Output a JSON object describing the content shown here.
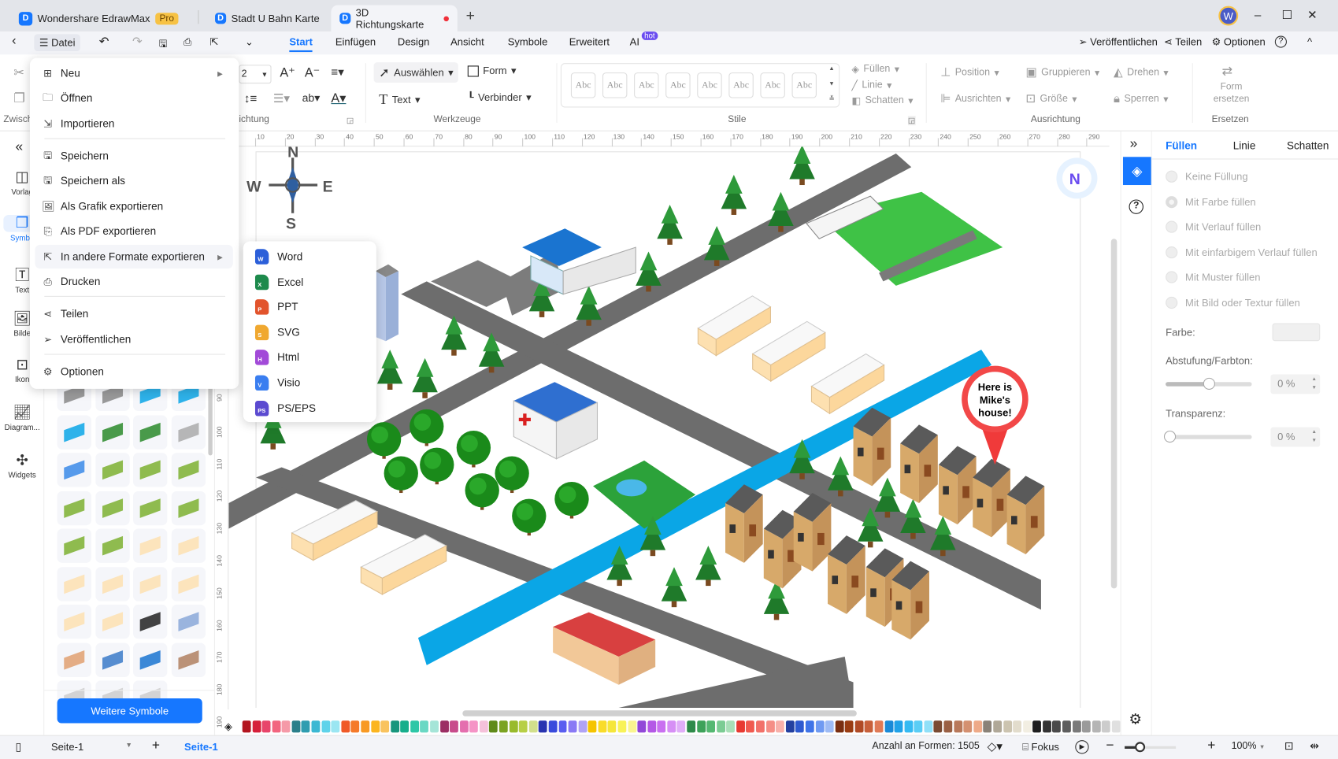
{
  "titlebar": {
    "app_name": "Wondershare EdrawMax",
    "pro_badge": "Pro",
    "tabs": [
      {
        "label": "Stadt U Bahn Karte"
      },
      {
        "label": "3D Richtungskarte",
        "unsaved": true
      }
    ],
    "new_tab": "+",
    "avatar_letter": "W",
    "minimize": "–",
    "maximize": "☐",
    "close": "✕"
  },
  "menubar": {
    "back": "‹",
    "datei": "Datei",
    "undo": "↶",
    "redo": "↷",
    "tabs": [
      "Start",
      "Einfügen",
      "Design",
      "Ansicht",
      "Symbole",
      "Erweitert",
      "AI"
    ],
    "active_tab": "Start",
    "ai_badge": "hot",
    "right": {
      "publish": "Veröffentlichen",
      "share": "Teilen",
      "options": "Optionen",
      "help": "?",
      "collapse": "^"
    }
  },
  "ribbon": {
    "font_size": "2",
    "select": "Auswählen",
    "form": "Form",
    "text": "Text",
    "connector": "Verbinder",
    "style_sample": "Abc",
    "fill": "Füllen",
    "line": "Linie",
    "shadow": "Schatten",
    "position": "Position",
    "group": "Gruppieren",
    "rotate": "Drehen",
    "align": "Ausrichten",
    "size": "Größe",
    "lock": "Sperren",
    "replace_form": "Form ersetzen",
    "groups": {
      "clipboard": "Zwisch",
      "alignment_partial": "ichtung",
      "tools": "Werkzeuge",
      "styles": "Stile",
      "arrangement": "Ausrichtung",
      "replace": "Ersetzen"
    }
  },
  "left_sidebar": {
    "collapse": "«",
    "items": [
      {
        "label": "Vorlag",
        "icon": "template-icon"
      },
      {
        "label": "Symbo",
        "icon": "symbols-icon",
        "active": true
      },
      {
        "label": "Text",
        "icon": "text-icon"
      },
      {
        "label": "Bilde",
        "icon": "image-icon"
      },
      {
        "label": "Ikon",
        "icon": "icon-icon"
      },
      {
        "label": "Diagram...",
        "icon": "chart-icon"
      },
      {
        "label": "Widgets",
        "icon": "puzzle-icon"
      }
    ]
  },
  "symbol_panel": {
    "more_button": "Weitere Symbole"
  },
  "file_menu": {
    "items": [
      {
        "label": "Neu",
        "icon": "plus-square-icon",
        "submenu": true
      },
      {
        "label": "Öffnen",
        "icon": "folder-icon"
      },
      {
        "label": "Importieren",
        "icon": "import-icon"
      },
      {
        "label": "Speichern",
        "icon": "save-icon"
      },
      {
        "label": "Speichern als",
        "icon": "save-as-icon"
      },
      {
        "label": "Als Grafik exportieren",
        "icon": "image-export-icon"
      },
      {
        "label": "Als PDF exportieren",
        "icon": "pdf-export-icon"
      },
      {
        "label": "In andere Formate exportieren",
        "icon": "export-icon",
        "submenu": true,
        "highlighted": true
      },
      {
        "label": "Drucken",
        "icon": "print-icon"
      },
      {
        "label": "Teilen",
        "icon": "share-icon"
      },
      {
        "label": "Veröffentlichen",
        "icon": "publish-icon"
      },
      {
        "label": "Optionen",
        "icon": "gear-icon"
      }
    ]
  },
  "export_submenu": {
    "items": [
      {
        "label": "Word",
        "letter": "W",
        "color": "#2b5fd9"
      },
      {
        "label": "Excel",
        "letter": "X",
        "color": "#1d8a4c"
      },
      {
        "label": "PPT",
        "letter": "P",
        "color": "#e2542c"
      },
      {
        "label": "SVG",
        "letter": "S",
        "color": "#f0a830"
      },
      {
        "label": "Html",
        "letter": "H",
        "color": "#a24ad8"
      },
      {
        "label": "Visio",
        "letter": "V",
        "color": "#3a7ef0"
      },
      {
        "label": "PS/EPS",
        "letter": "PS",
        "color": "#5b4ad0"
      }
    ]
  },
  "ruler": {
    "top": [
      "10",
      "20",
      "30",
      "40",
      "50",
      "60",
      "70",
      "80",
      "90",
      "100",
      "110",
      "120",
      "130",
      "140",
      "150",
      "160",
      "170",
      "180",
      "190",
      "200",
      "210",
      "220",
      "230",
      "240",
      "250",
      "260",
      "270",
      "280",
      "290"
    ],
    "left": [
      "90",
      "100",
      "110",
      "120",
      "130",
      "140",
      "150",
      "160",
      "170",
      "180",
      "190"
    ]
  },
  "canvas": {
    "compass": {
      "n": "N",
      "w": "W",
      "e": "E",
      "s": "S"
    },
    "callout": [
      "Here is",
      "Mike's",
      "house!"
    ]
  },
  "right_panel": {
    "tabs": [
      "Füllen",
      "Linie",
      "Schatten"
    ],
    "active_tab": "Füllen",
    "fill_options": [
      {
        "label": "Keine Füllung"
      },
      {
        "label": "Mit Farbe füllen",
        "selected": true
      },
      {
        "label": "Mit Verlauf füllen"
      },
      {
        "label": "Mit einfarbigem Verlauf füllen"
      },
      {
        "label": "Mit Muster füllen"
      },
      {
        "label": "Mit Bild oder Textur füllen"
      }
    ],
    "color_label": "Farbe:",
    "shade_label": "Abstufung/Farbton:",
    "shade_value": "0 %",
    "shade_slider": 0.5,
    "transparency_label": "Transparenz:",
    "transparency_value": "0 %",
    "transparency_slider": 0
  },
  "palette": [
    "#b3151f",
    "#d6203a",
    "#e8456a",
    "#f2657f",
    "#f59aa8",
    "#2b7f8a",
    "#2f9db0",
    "#3bb8d3",
    "#5fd3ea",
    "#9be6f2",
    "#f05a28",
    "#f57a2a",
    "#f89a24",
    "#fbb520",
    "#f9c35e",
    "#17967d",
    "#17ae8c",
    "#2ec7a7",
    "#6ad8c4",
    "#a5e5d8",
    "#9c2f64",
    "#c84c8c",
    "#e46fae",
    "#f594c6",
    "#f5c1da",
    "#5f8a1a",
    "#7ba322",
    "#98ba2c",
    "#b7cf46",
    "#d2e08c",
    "#2934b0",
    "#3a4bdc",
    "#5a5ef0",
    "#8a7af5",
    "#b0a3f5",
    "#f5c400",
    "#f9dc2a",
    "#f5e63a",
    "#f8f258",
    "#faf590",
    "#9248d8",
    "#b458e6",
    "#c970f0",
    "#d68ff5",
    "#e0aef8",
    "#2e8a4a",
    "#3ea25a",
    "#55b872",
    "#7ccc94",
    "#a9dfb8",
    "#e83a32",
    "#f05a50",
    "#f2716a",
    "#f58e86",
    "#f8b0aa",
    "#2340a0",
    "#2e5ad0",
    "#3f74e8",
    "#6f9af2",
    "#9ebbf5",
    "#7a2e10",
    "#9a3c12",
    "#b04a25",
    "#c8603a",
    "#e07a56",
    "#1a8ad8",
    "#22a2e8",
    "#36baf2",
    "#5acdf5",
    "#90e0f8",
    "#7a4a32",
    "#9a6044",
    "#b8785a",
    "#d49070",
    "#eeaa88",
    "#8a8278",
    "#b0a898",
    "#ccc4b0",
    "#e2dccc",
    "#f2eee2",
    "#1e1e1e",
    "#333333",
    "#4a4a4a",
    "#5e5e5e",
    "#7a7a7a",
    "#9a9a9a",
    "#b5b5b5",
    "#cccccc",
    "#e0e0e0",
    "#efefef"
  ],
  "statusbar": {
    "page_select": "Seite-1",
    "add_page": "+",
    "active_page": "Seite-1",
    "shape_count": "Anzahl an Formen: 1505",
    "focus": "Fokus",
    "zoom_out": "−",
    "zoom_in": "+",
    "zoom": "100%",
    "zoom_slider": 0.5
  }
}
